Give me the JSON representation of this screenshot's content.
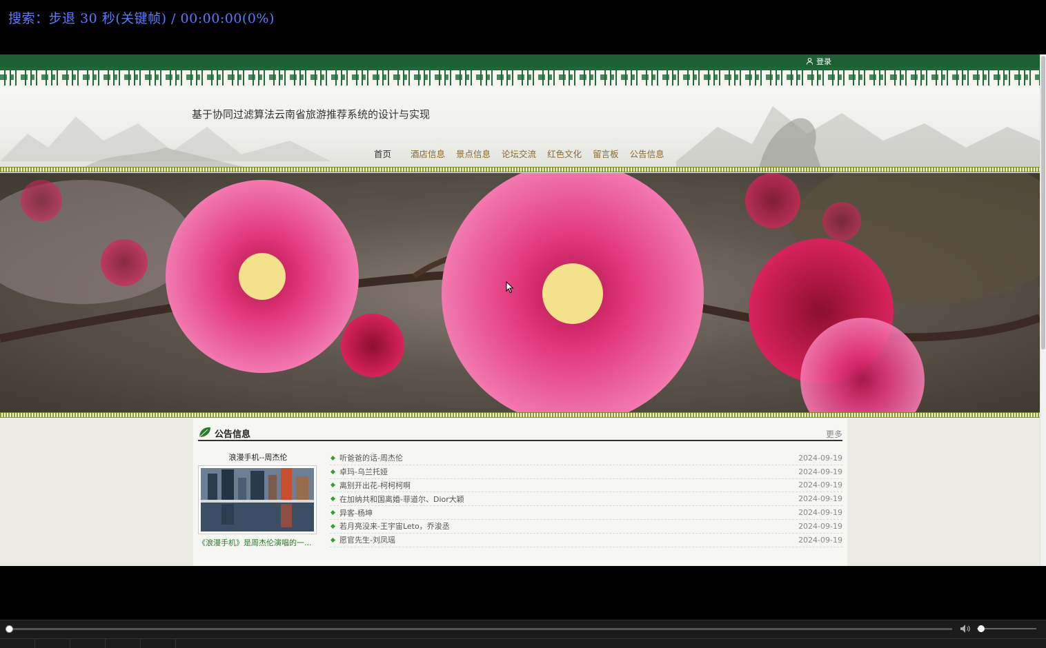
{
  "osd": {
    "text": "搜索：步退 30 秒(关键帧) / 00:00:00(0%)"
  },
  "topbar": {
    "login_label": "登录"
  },
  "header": {
    "site_title": "基于协同过滤算法云南省旅游推荐系统的设计与实现",
    "nav": [
      "首页",
      "酒店信息",
      "景点信息",
      "论坛交流",
      "红色文化",
      "留言板",
      "公告信息"
    ]
  },
  "notices": {
    "section_title": "公告信息",
    "more_label": "更多",
    "featured": {
      "title": "浪漫手机--周杰伦",
      "caption": "《浪漫手机》是周杰伦演唱的一..."
    },
    "items": [
      {
        "title": "听爸爸的话-周杰伦",
        "date": "2024-09-19"
      },
      {
        "title": "卓玛-乌兰托娅",
        "date": "2024-09-19"
      },
      {
        "title": "离别开出花-柯柯柯啊",
        "date": "2024-09-19"
      },
      {
        "title": "在加纳共和国离婚-菲道尔、Dior大颖",
        "date": "2024-09-19"
      },
      {
        "title": "异客-杨坤",
        "date": "2024-09-19"
      },
      {
        "title": "若月亮没来-王宇宙Leto，乔浚丞",
        "date": "2024-09-19"
      },
      {
        "title": "愿官先生-刘凤瑶",
        "date": "2024-09-19"
      }
    ]
  },
  "player": {
    "seek_percent": 0,
    "volume_fraction": 0.05
  },
  "colors": {
    "accent_green": "#1f5f34",
    "nav_gold": "#8a6a2a",
    "osd_blue": "#5b7cff"
  }
}
